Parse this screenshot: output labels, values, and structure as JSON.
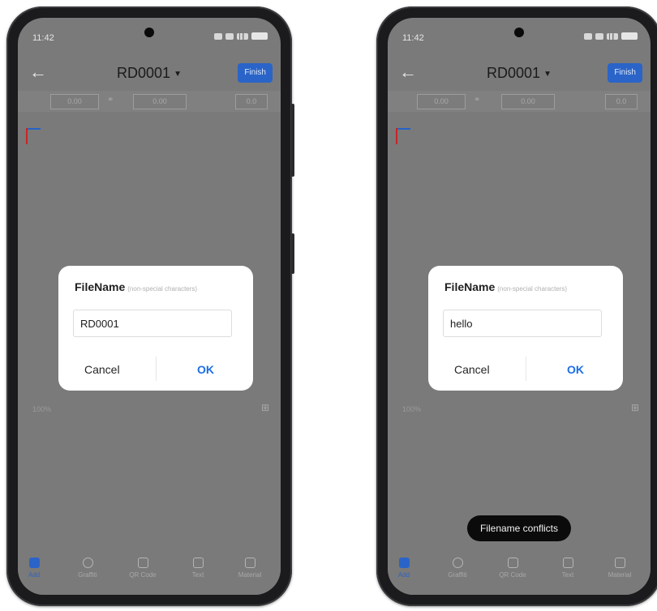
{
  "phones": [
    {
      "status": {
        "time": "11:42"
      },
      "appbar": {
        "title": "RD0001",
        "finish_label": "Finish"
      },
      "coords": {
        "x": "0.00",
        "y": "0.00",
        "z": "0.0"
      },
      "canvas": {
        "zoom_label": "100%"
      },
      "dialog": {
        "title": "FileName",
        "hint": "(non-special characters)",
        "input_value": "RD0001",
        "cancel_label": "Cancel",
        "ok_label": "OK"
      },
      "nav": {
        "add": "Add",
        "graffiti": "Graffiti",
        "qr": "QR Code",
        "text": "Text",
        "material": "Material"
      }
    },
    {
      "status": {
        "time": "11:42"
      },
      "appbar": {
        "title": "RD0001",
        "finish_label": "Finish"
      },
      "coords": {
        "x": "0.00",
        "y": "0.00",
        "z": "0.0"
      },
      "canvas": {
        "zoom_label": "100%"
      },
      "dialog": {
        "title": "FileName",
        "hint": "(non-special characters)",
        "input_value": "hello",
        "cancel_label": "Cancel",
        "ok_label": "OK"
      },
      "toast": "Filename conflicts",
      "nav": {
        "add": "Add",
        "graffiti": "Graffiti",
        "qr": "QR Code",
        "text": "Text",
        "material": "Material"
      }
    }
  ],
  "colors": {
    "accent": "#2a64c8",
    "ok": "#1c6ee6",
    "overlay": "#7a7a7a"
  }
}
